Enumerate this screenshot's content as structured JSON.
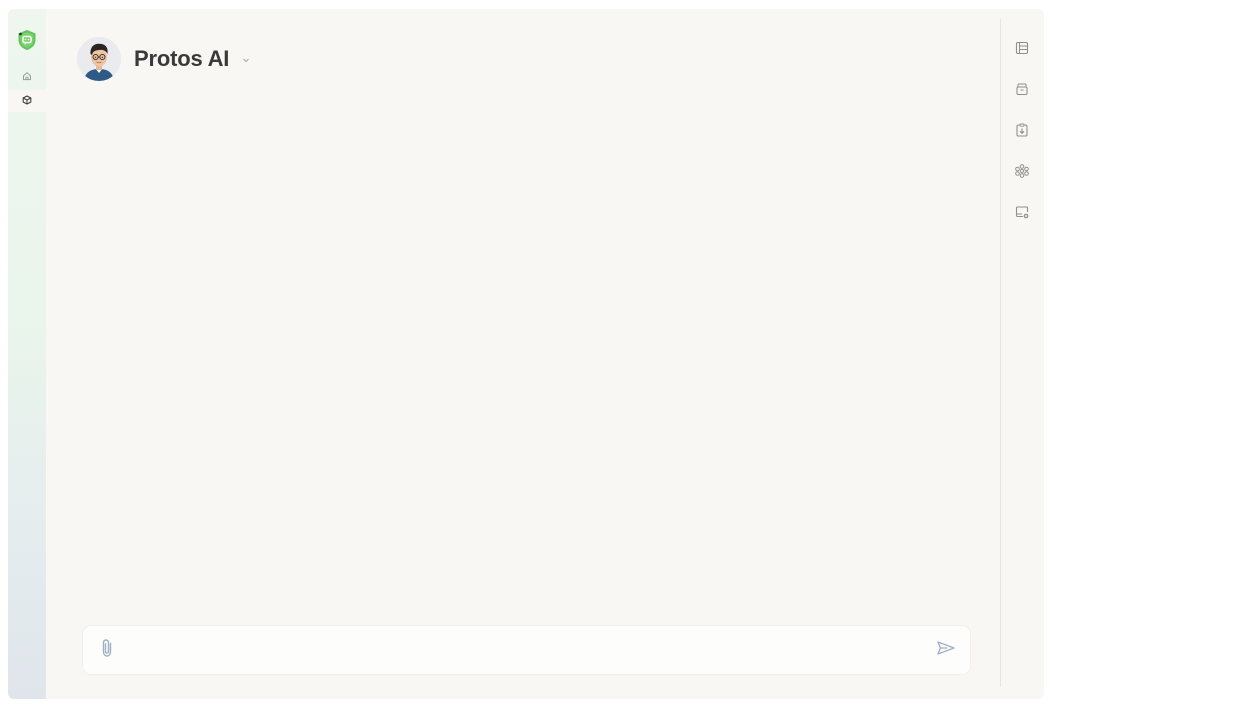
{
  "agent": {
    "name": "Protos AI"
  },
  "composer": {
    "value": "",
    "placeholder": ""
  },
  "icons": {
    "logo": "shield-logo-icon",
    "home": "home-icon",
    "agents": "cube-icon",
    "attach": "paperclip-icon",
    "send": "send-icon",
    "right_rail": [
      "list-panel-icon",
      "archive-box-icon",
      "clipboard-download-icon",
      "flower-network-icon",
      "screen-settings-icon"
    ]
  },
  "colors": {
    "brand_green": "#5fc45a",
    "canvas": "#f8f7f4",
    "title": "#3a3a3a",
    "icon_muted": "#8f8f8f",
    "send_icon": "#9fb1c2"
  }
}
